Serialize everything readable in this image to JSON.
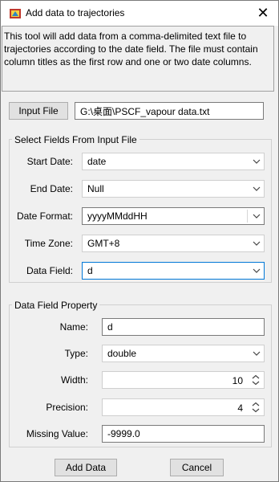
{
  "window": {
    "title": "Add data to trajectories",
    "close_glyph": "✕",
    "icon": "app-icon"
  },
  "description": "This tool will add data from a comma-delimited text file to trajectories according to the date field. The file must contain column titles as the first row and one or two date columns.",
  "input": {
    "button_label": "Input File",
    "path": "G:\\桌面\\PSCF_vapour data.txt"
  },
  "select_fields": {
    "title": "Select Fields From Input File",
    "start_date": {
      "label": "Start Date:",
      "value": "date"
    },
    "end_date": {
      "label": "End Date:",
      "value": "Null"
    },
    "date_format": {
      "label": "Date Format:",
      "value": "yyyyMMddHH"
    },
    "time_zone": {
      "label": "Time Zone:",
      "value": "GMT+8"
    },
    "data_field": {
      "label": "Data Field:",
      "value": "d"
    }
  },
  "property": {
    "title": "Data Field Property",
    "name": {
      "label": "Name:",
      "value": "d"
    },
    "type": {
      "label": "Type:",
      "value": "double"
    },
    "width": {
      "label": "Width:",
      "value": "10"
    },
    "precision": {
      "label": "Precision:",
      "value": "4"
    },
    "missing": {
      "label": "Missing Value:",
      "value": "-9999.0"
    }
  },
  "footer": {
    "add_label": "Add Data",
    "cancel_label": "Cancel"
  }
}
